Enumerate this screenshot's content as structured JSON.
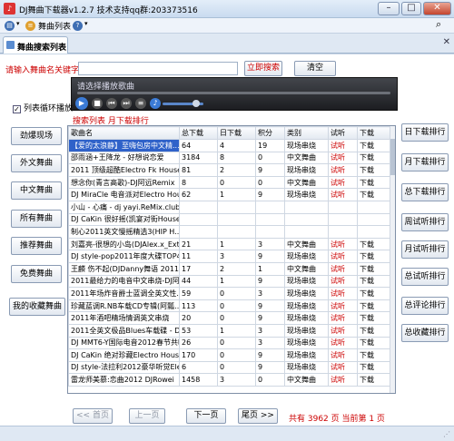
{
  "window": {
    "title": "DJ舞曲下载器v1.2.7 技术支持qq群:203373516"
  },
  "menubar": {
    "items": [
      "舞曲列表"
    ]
  },
  "tab": {
    "label": "舞曲搜索列表"
  },
  "search": {
    "label": "请输入舞曲名关键字:",
    "value": "",
    "search_button": "立即搜索",
    "clear_button": "清空"
  },
  "player": {
    "status": "请选择播放歌曲"
  },
  "loop": {
    "label": "列表循环播放",
    "checked": true
  },
  "ranking": {
    "title": "搜索列表 月下载排行"
  },
  "left_nav": [
    "劲爆现场",
    "外文舞曲",
    "中文舞曲",
    "所有舞曲",
    "推荐舞曲",
    "免费舞曲",
    "我的收藏舞曲"
  ],
  "right_nav": [
    "日下载排行",
    "月下载排行",
    "总下载排行",
    "周试听排行",
    "月试听排行",
    "总试听排行",
    "总评论排行",
    "总收藏排行"
  ],
  "table": {
    "headers": [
      "歌曲名",
      "总下载",
      "日下载",
      "积分",
      "类别",
      "试听",
      "下载"
    ],
    "rows": [
      [
        "【爱的太浪静】至嗨包房中文精...",
        "64",
        "4",
        "19",
        "现场串烧",
        "试听",
        "下载"
      ],
      [
        "邵雨涵+王降龙 - 好想说恋爱",
        "3184",
        "8",
        "0",
        "中文舞曲",
        "试听",
        "下载"
      ],
      [
        "2011 顶级超酷Electro Fk House音...",
        "81",
        "2",
        "9",
        "现场串烧",
        "试听",
        "下载"
      ],
      [
        "想念你(青言高歌)-DJ阿远Remix",
        "8",
        "0",
        "0",
        "中文舞曲",
        "试听",
        "下载"
      ],
      [
        "DJ MiraCle 电音派对Electro House...",
        "62",
        "1",
        "9",
        "现场串烧",
        "试听",
        "下载"
      ],
      [
        "小山 - 心痛 - dj yayi.ReMix.club 2...",
        "",
        "",
        "",
        "",
        "",
        ""
      ],
      [
        "DJ CaKin 很好摇(凯宴对街House...",
        "",
        "",
        "",
        "",
        "",
        ""
      ],
      [
        "制心2011英文慢摇精选3(HIP H...",
        "",
        "",
        "",
        "",
        "",
        ""
      ],
      [
        "刘嘉亮-很想的小岛(DJAlex.x_Ext...",
        "21",
        "1",
        "3",
        "中文舞曲",
        "试听",
        "下载"
      ],
      [
        "DJ style-pop2011年度大碟TOP40...",
        "11",
        "3",
        "9",
        "现场串烧",
        "试听",
        "下载"
      ],
      [
        "王麟 伤不起(DJDanny舞语 2011Mix)",
        "17",
        "2",
        "1",
        "中文舞曲",
        "试听",
        "下载"
      ],
      [
        "2011最给力的电音中文串烧-DJ阿满",
        "44",
        "1",
        "9",
        "现场串烧",
        "试听",
        "下载"
      ],
      [
        "2011年场炸音爵士蓝调全英文性...",
        "59",
        "0",
        "3",
        "现场串烧",
        "试听",
        "下载"
      ],
      [
        "珍藏蓝调R.NB车载CD专辑(阿瓢...",
        "113",
        "0",
        "9",
        "现场串烧",
        "试听",
        "下载"
      ],
      [
        "2011年酒吧精场情调英文串烧",
        "20",
        "0",
        "9",
        "现场串烧",
        "试听",
        "下载"
      ],
      [
        "2011全英文极品Blues车载碟 - DJ...",
        "53",
        "1",
        "3",
        "现场串烧",
        "试听",
        "下载"
      ],
      [
        "DJ MMT6-Y国际电音2012春节共听...",
        "26",
        "0",
        "3",
        "现场串烧",
        "试听",
        "下载"
      ],
      [
        "DJ CaKin 绝对珍藏Electro House...",
        "170",
        "0",
        "9",
        "现场串烧",
        "试听",
        "下载"
      ],
      [
        "DJ style-法拉利2012豪华听觉Elec...",
        "6",
        "0",
        "9",
        "现场串烧",
        "试听",
        "下载"
      ],
      [
        "雷龙师美慕:恋曲2012 DJRowei",
        "1458",
        "3",
        "0",
        "中文舞曲",
        "试听",
        "下载"
      ]
    ],
    "selected_row": 0
  },
  "pager": {
    "first": "<< 首页",
    "prev": "上一页",
    "next": "下一页",
    "last": "尾页 >>",
    "info": "共有 3962 页 当前第 1 页"
  }
}
